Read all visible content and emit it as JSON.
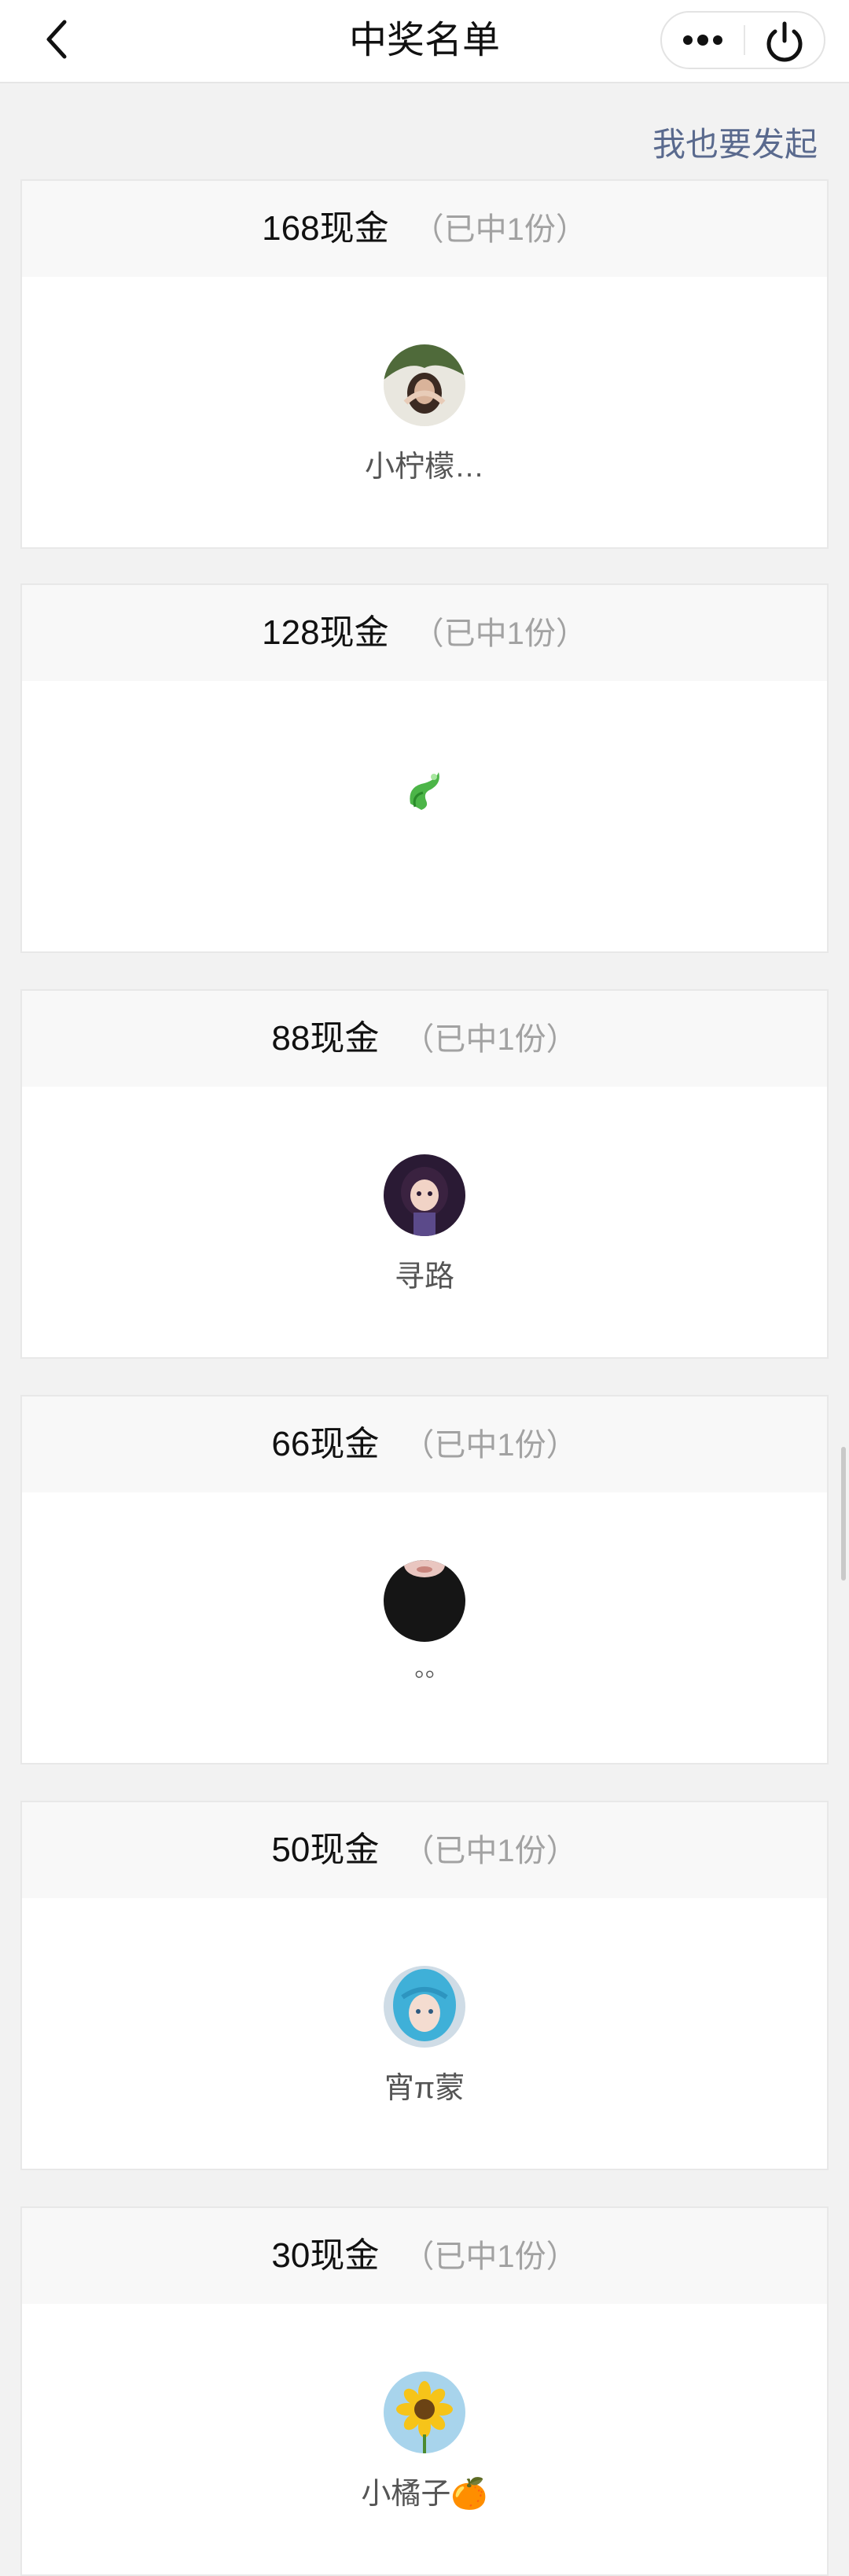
{
  "nav": {
    "title": "中奖名单",
    "back_icon": "chevron-left-icon",
    "more_icon": "more-dots-icon",
    "power_icon": "power-icon"
  },
  "initiate_link": "我也要发起",
  "prizes": [
    {
      "name": "168现金",
      "count": "（已中1份）",
      "winner": "小柠檬…"
    },
    {
      "name": "128现金",
      "count": "（已中1份）",
      "winner": ""
    },
    {
      "name": "88现金",
      "count": "（已中1份）",
      "winner": "寻路"
    },
    {
      "name": "66现金",
      "count": "（已中1份）",
      "winner": "◦◦"
    },
    {
      "name": "50现金",
      "count": "（已中1份）",
      "winner": "宵π蒙"
    },
    {
      "name": "30现金",
      "count": "（已中1份）",
      "winner": "小橘子🍊"
    }
  ]
}
